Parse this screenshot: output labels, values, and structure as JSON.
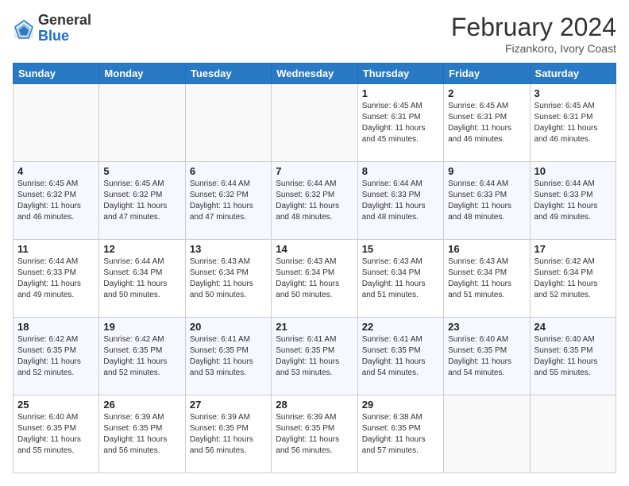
{
  "header": {
    "logo_general": "General",
    "logo_blue": "Blue",
    "month_title": "February 2024",
    "location": "Fizankoro, Ivory Coast"
  },
  "days_of_week": [
    "Sunday",
    "Monday",
    "Tuesday",
    "Wednesday",
    "Thursday",
    "Friday",
    "Saturday"
  ],
  "weeks": [
    [
      {
        "day": "",
        "info": ""
      },
      {
        "day": "",
        "info": ""
      },
      {
        "day": "",
        "info": ""
      },
      {
        "day": "",
        "info": ""
      },
      {
        "day": "1",
        "info": "Sunrise: 6:45 AM\nSunset: 6:31 PM\nDaylight: 11 hours\nand 45 minutes."
      },
      {
        "day": "2",
        "info": "Sunrise: 6:45 AM\nSunset: 6:31 PM\nDaylight: 11 hours\nand 46 minutes."
      },
      {
        "day": "3",
        "info": "Sunrise: 6:45 AM\nSunset: 6:31 PM\nDaylight: 11 hours\nand 46 minutes."
      }
    ],
    [
      {
        "day": "4",
        "info": "Sunrise: 6:45 AM\nSunset: 6:32 PM\nDaylight: 11 hours\nand 46 minutes."
      },
      {
        "day": "5",
        "info": "Sunrise: 6:45 AM\nSunset: 6:32 PM\nDaylight: 11 hours\nand 47 minutes."
      },
      {
        "day": "6",
        "info": "Sunrise: 6:44 AM\nSunset: 6:32 PM\nDaylight: 11 hours\nand 47 minutes."
      },
      {
        "day": "7",
        "info": "Sunrise: 6:44 AM\nSunset: 6:32 PM\nDaylight: 11 hours\nand 48 minutes."
      },
      {
        "day": "8",
        "info": "Sunrise: 6:44 AM\nSunset: 6:33 PM\nDaylight: 11 hours\nand 48 minutes."
      },
      {
        "day": "9",
        "info": "Sunrise: 6:44 AM\nSunset: 6:33 PM\nDaylight: 11 hours\nand 48 minutes."
      },
      {
        "day": "10",
        "info": "Sunrise: 6:44 AM\nSunset: 6:33 PM\nDaylight: 11 hours\nand 49 minutes."
      }
    ],
    [
      {
        "day": "11",
        "info": "Sunrise: 6:44 AM\nSunset: 6:33 PM\nDaylight: 11 hours\nand 49 minutes."
      },
      {
        "day": "12",
        "info": "Sunrise: 6:44 AM\nSunset: 6:34 PM\nDaylight: 11 hours\nand 50 minutes."
      },
      {
        "day": "13",
        "info": "Sunrise: 6:43 AM\nSunset: 6:34 PM\nDaylight: 11 hours\nand 50 minutes."
      },
      {
        "day": "14",
        "info": "Sunrise: 6:43 AM\nSunset: 6:34 PM\nDaylight: 11 hours\nand 50 minutes."
      },
      {
        "day": "15",
        "info": "Sunrise: 6:43 AM\nSunset: 6:34 PM\nDaylight: 11 hours\nand 51 minutes."
      },
      {
        "day": "16",
        "info": "Sunrise: 6:43 AM\nSunset: 6:34 PM\nDaylight: 11 hours\nand 51 minutes."
      },
      {
        "day": "17",
        "info": "Sunrise: 6:42 AM\nSunset: 6:34 PM\nDaylight: 11 hours\nand 52 minutes."
      }
    ],
    [
      {
        "day": "18",
        "info": "Sunrise: 6:42 AM\nSunset: 6:35 PM\nDaylight: 11 hours\nand 52 minutes."
      },
      {
        "day": "19",
        "info": "Sunrise: 6:42 AM\nSunset: 6:35 PM\nDaylight: 11 hours\nand 52 minutes."
      },
      {
        "day": "20",
        "info": "Sunrise: 6:41 AM\nSunset: 6:35 PM\nDaylight: 11 hours\nand 53 minutes."
      },
      {
        "day": "21",
        "info": "Sunrise: 6:41 AM\nSunset: 6:35 PM\nDaylight: 11 hours\nand 53 minutes."
      },
      {
        "day": "22",
        "info": "Sunrise: 6:41 AM\nSunset: 6:35 PM\nDaylight: 11 hours\nand 54 minutes."
      },
      {
        "day": "23",
        "info": "Sunrise: 6:40 AM\nSunset: 6:35 PM\nDaylight: 11 hours\nand 54 minutes."
      },
      {
        "day": "24",
        "info": "Sunrise: 6:40 AM\nSunset: 6:35 PM\nDaylight: 11 hours\nand 55 minutes."
      }
    ],
    [
      {
        "day": "25",
        "info": "Sunrise: 6:40 AM\nSunset: 6:35 PM\nDaylight: 11 hours\nand 55 minutes."
      },
      {
        "day": "26",
        "info": "Sunrise: 6:39 AM\nSunset: 6:35 PM\nDaylight: 11 hours\nand 56 minutes."
      },
      {
        "day": "27",
        "info": "Sunrise: 6:39 AM\nSunset: 6:35 PM\nDaylight: 11 hours\nand 56 minutes."
      },
      {
        "day": "28",
        "info": "Sunrise: 6:39 AM\nSunset: 6:35 PM\nDaylight: 11 hours\nand 56 minutes."
      },
      {
        "day": "29",
        "info": "Sunrise: 6:38 AM\nSunset: 6:35 PM\nDaylight: 11 hours\nand 57 minutes."
      },
      {
        "day": "",
        "info": ""
      },
      {
        "day": "",
        "info": ""
      }
    ]
  ]
}
